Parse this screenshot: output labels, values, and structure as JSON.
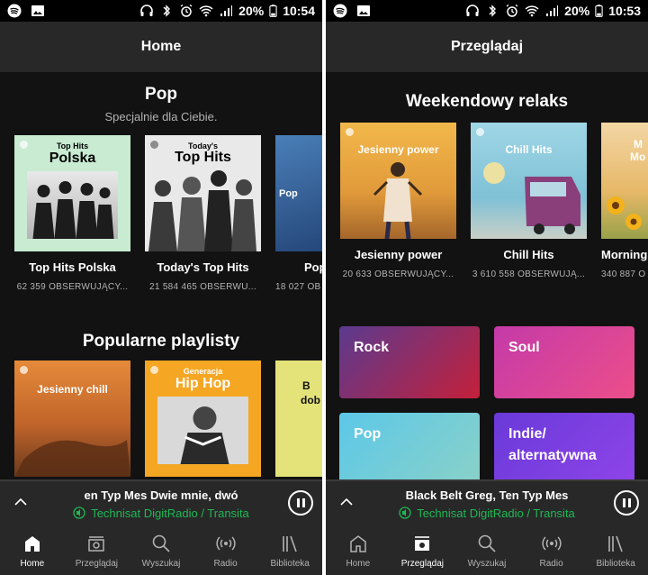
{
  "status": {
    "battery": "20%",
    "time_left": "10:54",
    "time_right": "10:53"
  },
  "left": {
    "header_title": "Home",
    "pop_section": {
      "title": "Pop",
      "subtitle": "Specjalnie dla Ciebie.",
      "cards": [
        {
          "cover_line1": "Top Hits",
          "cover_line2": "Polska",
          "name": "Top Hits Polska",
          "followers": "62 359 OBSERWUJĄCY..."
        },
        {
          "cover_line1": "Today's",
          "cover_line2": "Top Hits",
          "name": "Today's Top Hits",
          "followers": "21 584 465 OBSERWU..."
        },
        {
          "cover_line1": "Pop",
          "name": "Pop",
          "followers": "18 027 OB"
        }
      ]
    },
    "popular_section": {
      "title": "Popularne playlisty",
      "cards": [
        {
          "cover_line1": "Jesienny chill"
        },
        {
          "cover_line1": "Generacja",
          "cover_line2": "Hip Hop"
        },
        {
          "cover_line1": "B",
          "cover_line2": "dob"
        }
      ]
    },
    "player": {
      "title": "en Typ Mes       Dwie mnie, dwó",
      "device": "Technisat DigitRadio / Transita"
    }
  },
  "right": {
    "header_title": "Przeglądaj",
    "weekend_section": {
      "title": "Weekendowy relaks",
      "cards": [
        {
          "cover_line1": "Jesienny power",
          "name": "Jesienny power",
          "followers": "20 633 OBSERWUJĄCY..."
        },
        {
          "cover_line1": "Chill Hits",
          "name": "Chill Hits",
          "followers": "3 610 558 OBSERWUJĄ..."
        },
        {
          "cover_line1": "M",
          "cover_line2": "Mo",
          "name": "Morning",
          "followers": "340 887 O"
        }
      ]
    },
    "genres": [
      "Rock",
      "Soul",
      "Pop",
      "Indie/ alternatywna"
    ],
    "player": {
      "title": "Black Belt Greg, Ten Typ Mes",
      "device": "Technisat DigitRadio / Transita"
    }
  },
  "nav": [
    "Home",
    "Przeglądaj",
    "Wyszukaj",
    "Radio",
    "Biblioteka"
  ],
  "colors": {
    "accent": "#1db954",
    "background": "#121212",
    "bar": "#282828"
  }
}
